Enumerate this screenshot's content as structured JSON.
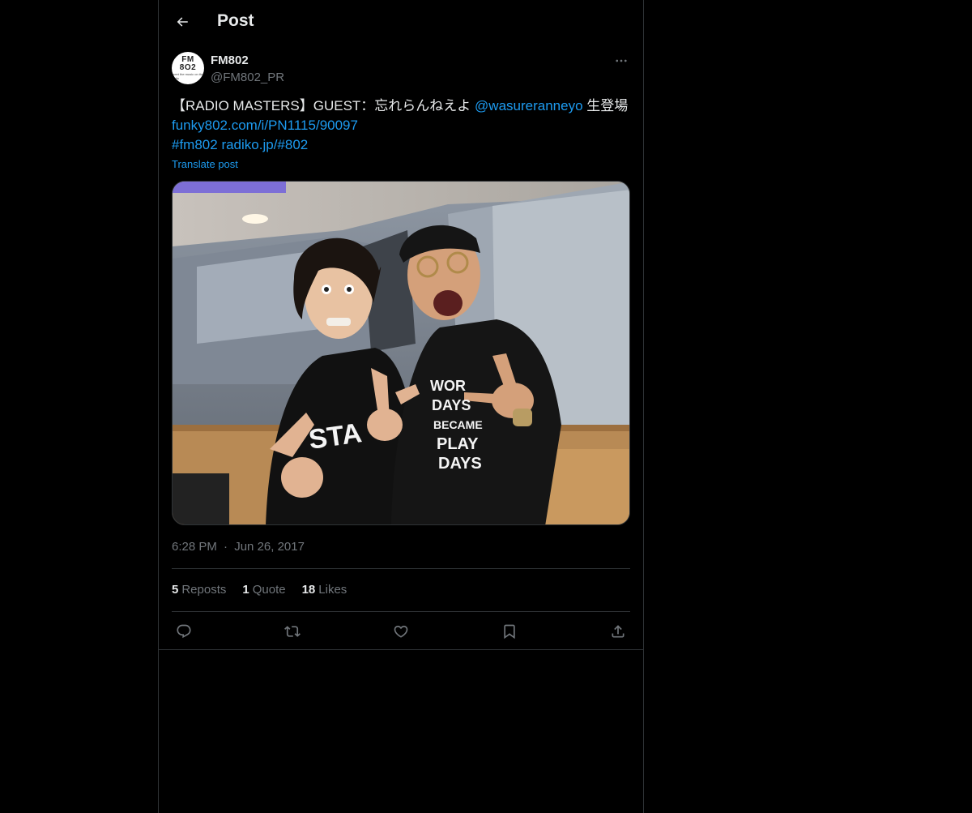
{
  "header": {
    "title": "Post"
  },
  "author": {
    "name": "FM802",
    "handle": "@FM802_PR",
    "avatar_text": {
      "line1": "FM",
      "line2": "8O2",
      "line3": "meet the music on the radio"
    }
  },
  "tweet": {
    "text_prefix": "【RADIO MASTERS】GUEST：忘れらんねえよ ",
    "mention": "@wasureranneyo",
    "text_suffix": " 生登場",
    "link1": "funky802.com/i/PN1115/90097",
    "hashtag": "#fm802",
    "link2": "radiko.jp/#802",
    "translate_label": "Translate post"
  },
  "meta": {
    "time": "6:28 PM",
    "separator": "·",
    "date": "Jun 26, 2017"
  },
  "stats": {
    "reposts_count": "5",
    "reposts_label": "Reposts",
    "quotes_count": "1",
    "quotes_label": "Quote",
    "likes_count": "18",
    "likes_label": "Likes"
  },
  "icons": {
    "back": "arrow-left-icon",
    "more": "more-horizontal-icon",
    "reply": "reply-icon",
    "repost": "repost-icon",
    "like": "heart-icon",
    "bookmark": "bookmark-icon",
    "share": "share-icon"
  },
  "colors": {
    "background": "#000000",
    "text": "#e7e9ea",
    "secondary": "#71767b",
    "link": "#1d9bf0",
    "border": "#2f3336"
  }
}
